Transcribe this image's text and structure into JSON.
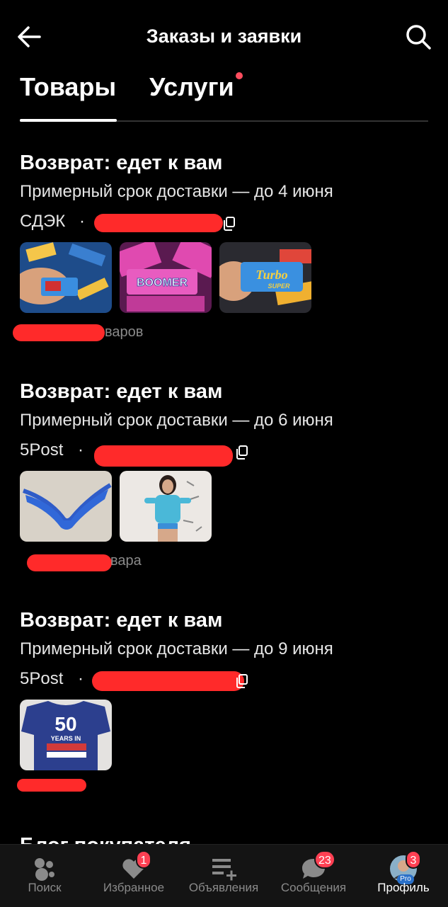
{
  "header": {
    "title": "Заказы и заявки"
  },
  "tabs": [
    {
      "label": "Товары"
    },
    {
      "label": "Услуги"
    }
  ],
  "orders": [
    {
      "title": "Возврат: едет к вам",
      "delivery": "Примерный срок доставки — до 4 июня",
      "carrier": "СДЭК",
      "count_text": "варов"
    },
    {
      "title": "Возврат: едет к вам",
      "delivery": "Примерный срок доставки — до 6 июня",
      "carrier": "5Post",
      "count_text": "вара"
    },
    {
      "title": "Возврат: едет к вам",
      "delivery": "Примерный срок доставки — до 9 июня",
      "carrier": "5Post",
      "count_text": ""
    }
  ],
  "thumb_text": {
    "boomer": "BOOMER",
    "turbo": "Turbo",
    "turbo_sub": "SUPER",
    "shirt_num": "50",
    "shirt_line": "YEARS IN"
  },
  "partial_next_title": "Блог покупателя",
  "nav": [
    {
      "label": "Поиск",
      "icon": "search-dots-icon",
      "badge": ""
    },
    {
      "label": "Избранное",
      "icon": "heart-icon",
      "badge": "1"
    },
    {
      "label": "Объявления",
      "icon": "add-listing-icon",
      "badge": ""
    },
    {
      "label": "Сообщения",
      "icon": "chat-icon",
      "badge": "23"
    },
    {
      "label": "Профиль",
      "icon": "avatar-icon",
      "badge": "3",
      "pro": "Pro"
    }
  ],
  "colors": {
    "accent_red": "#ff4053",
    "background": "#000000",
    "redaction": "#ff2a2a"
  }
}
